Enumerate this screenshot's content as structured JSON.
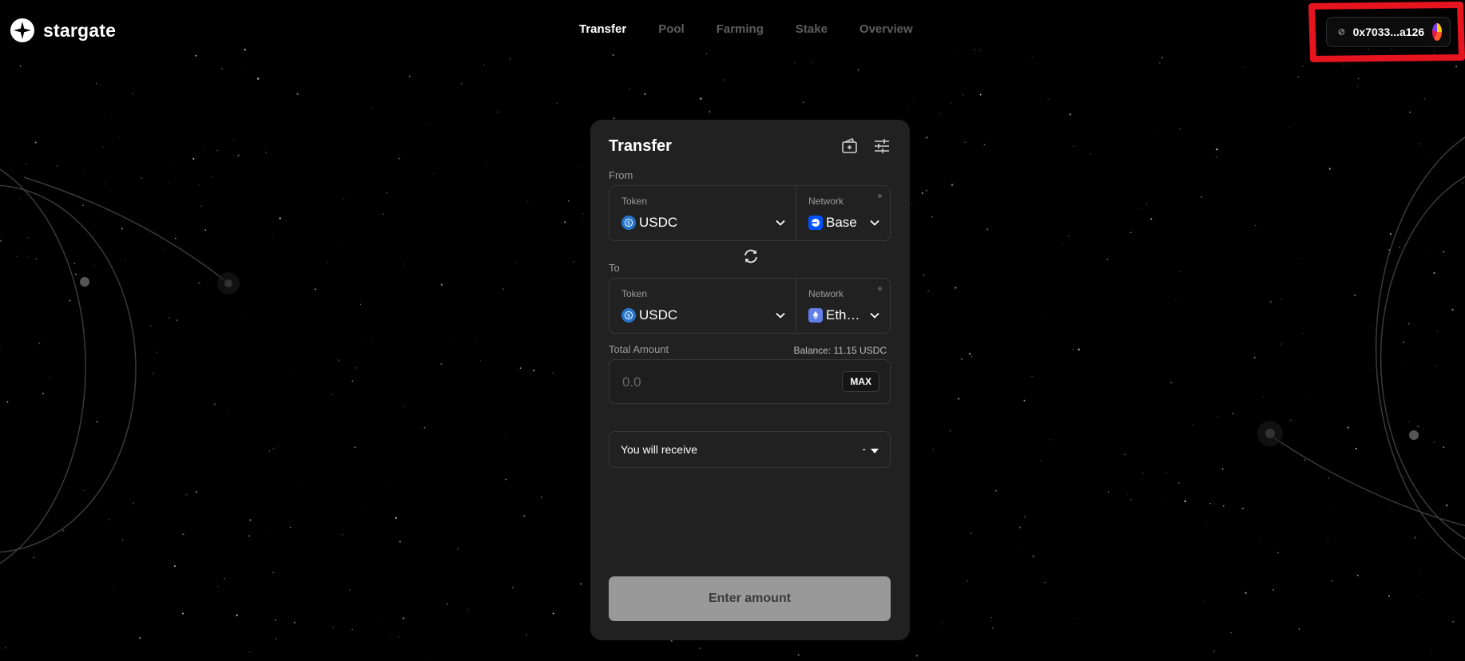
{
  "header": {
    "brand": "stargate",
    "nav": [
      {
        "label": "Transfer",
        "active": true
      },
      {
        "label": "Pool",
        "active": false
      },
      {
        "label": "Farming",
        "active": false
      },
      {
        "label": "Stake",
        "active": false
      },
      {
        "label": "Overview",
        "active": false
      }
    ],
    "wallet": {
      "address": "0x7033...a126"
    }
  },
  "transfer": {
    "title": "Transfer",
    "from": {
      "label": "From",
      "token_caption": "Token",
      "token": "USDC",
      "network_caption": "Network",
      "network": "Base"
    },
    "to": {
      "label": "To",
      "token_caption": "Token",
      "token": "USDC",
      "network_caption": "Network",
      "network": "Ethereum"
    },
    "amount": {
      "label": "Total Amount",
      "balance": "Balance: 11.15 USDC",
      "placeholder": "0.0",
      "max_label": "MAX"
    },
    "receive": {
      "label": "You will receive",
      "value": "-"
    },
    "submit_label": "Enter amount"
  },
  "colors": {
    "background": "#000000",
    "card": "#212121",
    "annotation": "#e5141e",
    "usdc": "#2775ca",
    "base": "#0052ff",
    "ethereum": "#627eea",
    "button_disabled": "#999999"
  },
  "icons": {
    "logo": "stargate-logo-icon",
    "wallet_status": "block-icon",
    "header_actions": [
      "add-wallet-icon",
      "settings-sliders-icon"
    ],
    "swap": "swap-icon",
    "chevron": "chevron-down-icon"
  }
}
